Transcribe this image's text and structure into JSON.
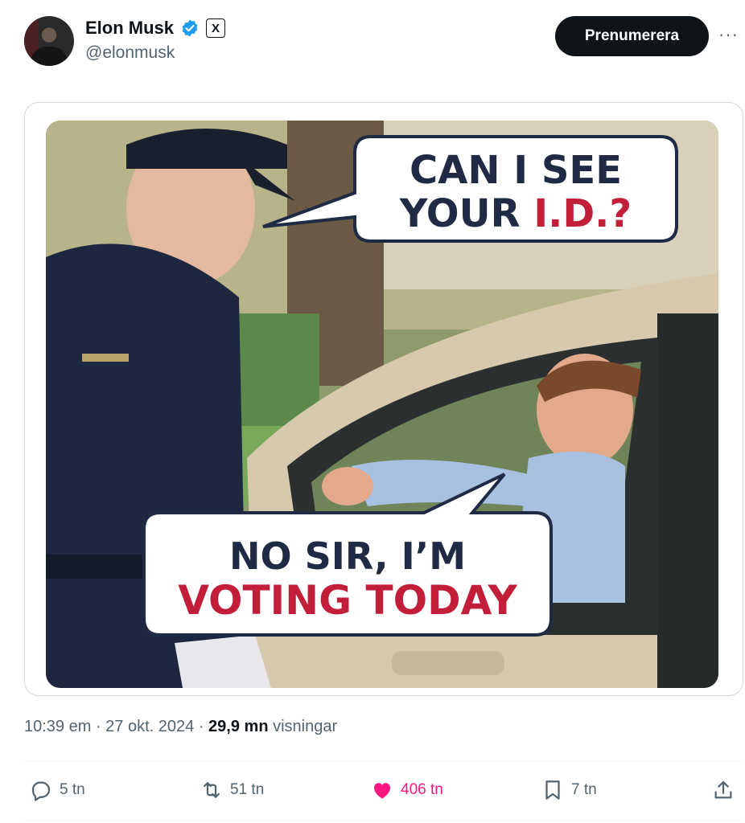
{
  "author": {
    "name": "Elon Musk",
    "handle": "@elonmusk",
    "verified_color": "#1d9bf0",
    "affiliation_badge": "X"
  },
  "header": {
    "subscribe_label": "Prenumerera",
    "more_label": "···"
  },
  "media": {
    "bubble_top_line1": "CAN I SEE",
    "bubble_top_line2_a": "YOUR ",
    "bubble_top_line2_b": "I.D.?",
    "bubble_bottom_line1": "NO SIR, I’M",
    "bubble_bottom_line2": "VOTING TODAY",
    "accent_color": "#c21e3a",
    "text_color": "#1f2a44"
  },
  "meta": {
    "time": "10:39 em",
    "sep1": " · ",
    "date": "27 okt. 2024",
    "sep2": " · ",
    "views_count": "29,9 mn",
    "views_label": "visningar"
  },
  "actions": {
    "replies": "5 tn",
    "reposts": "51 tn",
    "likes": "406 tn",
    "bookmarks": "7 tn",
    "like_color": "#f91880"
  }
}
